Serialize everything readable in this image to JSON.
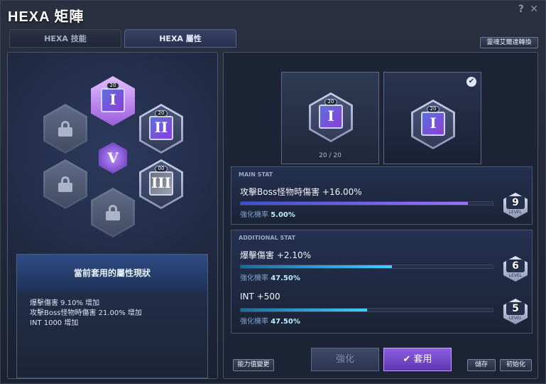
{
  "window": {
    "title": "HEXA 矩陣",
    "help_label": "?",
    "close_label": "✕"
  },
  "tabs": [
    {
      "label": "HEXA 技能"
    },
    {
      "label": "HEXA 屬性"
    }
  ],
  "convert_button": "靈魂艾爾達轉換",
  "board": {
    "center_symbol": "V",
    "cores": [
      {
        "position": "top",
        "state": "selected",
        "level": "20",
        "glyph": "I"
      },
      {
        "position": "upper-right",
        "state": "unlocked",
        "level": "20",
        "glyph": "II"
      },
      {
        "position": "lower-right",
        "state": "unlocked-dim",
        "level": "00",
        "glyph": "III"
      },
      {
        "position": "bottom",
        "state": "locked"
      },
      {
        "position": "lower-left",
        "state": "locked"
      },
      {
        "position": "upper-left",
        "state": "locked"
      }
    ]
  },
  "status": {
    "title": "當前套用的屬性現狀",
    "lines": [
      "爆擊傷害 9.10% 增加",
      "攻擊Boss怪物時傷害 21.00% 增加",
      "INT 1000 增加"
    ]
  },
  "preview": {
    "left_card": {
      "level": "20",
      "glyph": "I",
      "count": "20 / 20"
    },
    "right_card": {
      "level": "20",
      "glyph": "I",
      "check": "✔"
    }
  },
  "main_stat": {
    "section_label": "MAIN STAT",
    "name": "攻擊Boss怪物時傷害 +16.00%",
    "prob_label": "強化機率",
    "prob_value": "5.00%",
    "level": "9",
    "level_label": "LEVEL",
    "progress": 0.9
  },
  "additional_stat": {
    "section_label": "ADDITIONAL STAT",
    "stats": [
      {
        "name": "爆擊傷害 +2.10%",
        "prob_label": "強化機率",
        "prob_value": "47.50%",
        "level": "6",
        "level_label": "LEVEL",
        "progress": 0.6
      },
      {
        "name": "INT +500",
        "prob_label": "強化機率",
        "prob_value": "47.50%",
        "level": "5",
        "level_label": "LEVEL",
        "progress": 0.5
      }
    ]
  },
  "buttons": {
    "ability_change": "能力值變更",
    "upgrade": "強化",
    "apply": "套用",
    "apply_icon": "✔",
    "save": "儲存",
    "reset": "初始化"
  },
  "colors": {
    "accent": "#8c5ee0",
    "teal": "#3fd0ff",
    "panel": "#1d2435"
  }
}
